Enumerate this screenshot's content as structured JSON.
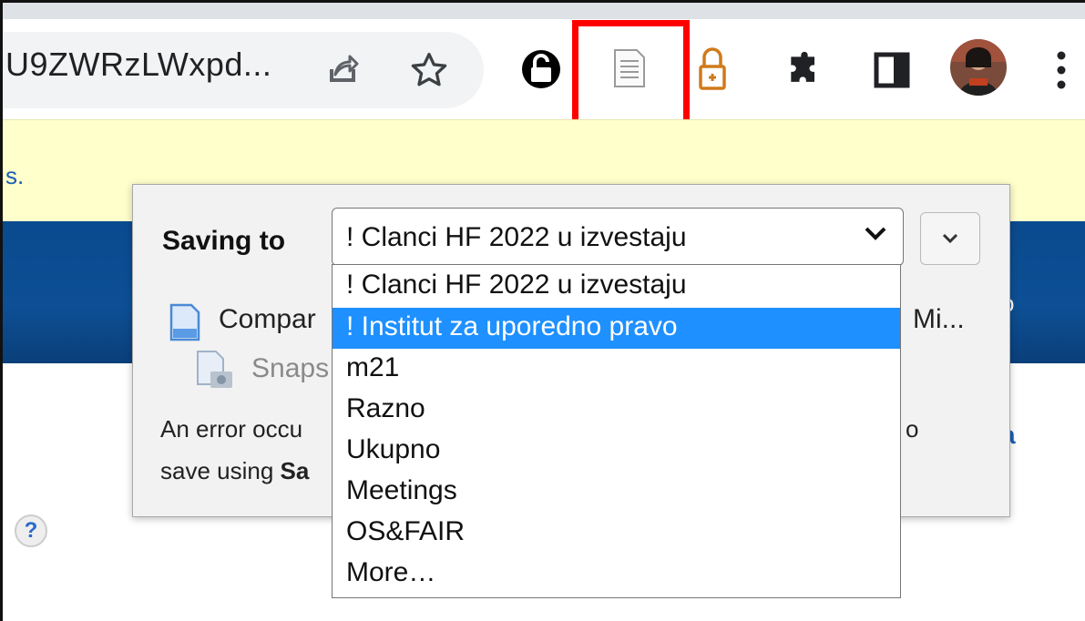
{
  "toolbar": {
    "url_text": "U9ZWRzLWxpd...",
    "icons": [
      "share-icon",
      "star-icon",
      "lock-extension-icon",
      "document-extension-icon",
      "padlock-extension-icon",
      "puzzle-extensions-icon",
      "side-panel-icon",
      "profile-avatar",
      "kebab-menu-icon"
    ]
  },
  "infobar": {
    "text": "s."
  },
  "banner": {
    "text": "o"
  },
  "side_link": {
    "text": "a"
  },
  "help": {
    "glyph": "?"
  },
  "popup": {
    "saving_label": "Saving to",
    "selected_collection": "! Clanci HF 2022 u izvestaju",
    "item_title_left": "Compar",
    "item_title_right": "Mi...",
    "snapshot_label": "Snaps",
    "error_line1_left": "An error occu",
    "error_line1_right": "o",
    "error_line2_left": "save using ",
    "error_line2_bold": "Sa"
  },
  "dropdown": {
    "options": [
      "! Clanci HF 2022 u izvestaju",
      "! Institut za uporedno pravo",
      "m21",
      "Razno",
      "Ukupno",
      "Meetings",
      "OS&FAIR",
      "More…"
    ],
    "selected_index": 1
  },
  "colors": {
    "highlight": "#ff0000",
    "selection": "#1e90ff",
    "infobar": "#ffffcc",
    "banner": "#0d4f94"
  }
}
